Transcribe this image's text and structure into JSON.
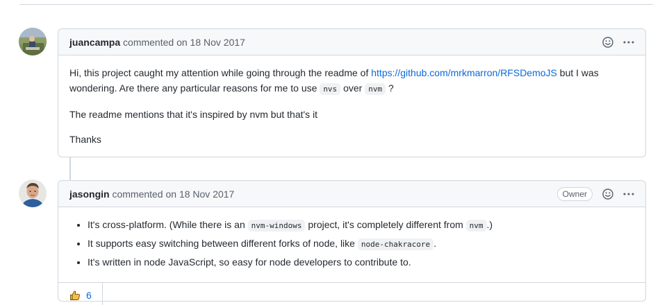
{
  "comments": [
    {
      "author": "juancampa",
      "verb": "commented on",
      "date": "18 Nov 2017",
      "body": {
        "p1_a": "Hi, this project caught my attention while going through the readme of ",
        "p1_link": "https://github.com/mrkmarron/RFSDemoJS",
        "p1_b": " but I was wondering. Are there any particular reasons for me to use ",
        "p1_code1": "nvs",
        "p1_c": " over ",
        "p1_code2": "nvm",
        "p1_d": " ?",
        "p2": "The readme mentions that it's inspired by nvm but that's it",
        "p3": "Thanks"
      }
    },
    {
      "author": "jasongin",
      "verb": "commented on",
      "date": "18 Nov 2017",
      "badge": "Owner",
      "body": {
        "li1_a": "It's cross-platform. (While there is an ",
        "li1_code": "nvm-windows",
        "li1_b": " project, it's completely different from ",
        "li1_code2": "nvm",
        "li1_c": ".)",
        "li2_a": "It supports easy switching between different forks of node, like ",
        "li2_code": "node-chakracore",
        "li2_b": ".",
        "li3": "It's written in node JavaScript, so easy for node developers to contribute to."
      },
      "reactions": [
        {
          "icon": "thumbs-up-icon",
          "count": "6"
        }
      ]
    }
  ],
  "colors": {
    "border": "#d0d7de",
    "header_bg": "#f6f8fa",
    "link": "#0969da",
    "muted": "#57606a"
  }
}
